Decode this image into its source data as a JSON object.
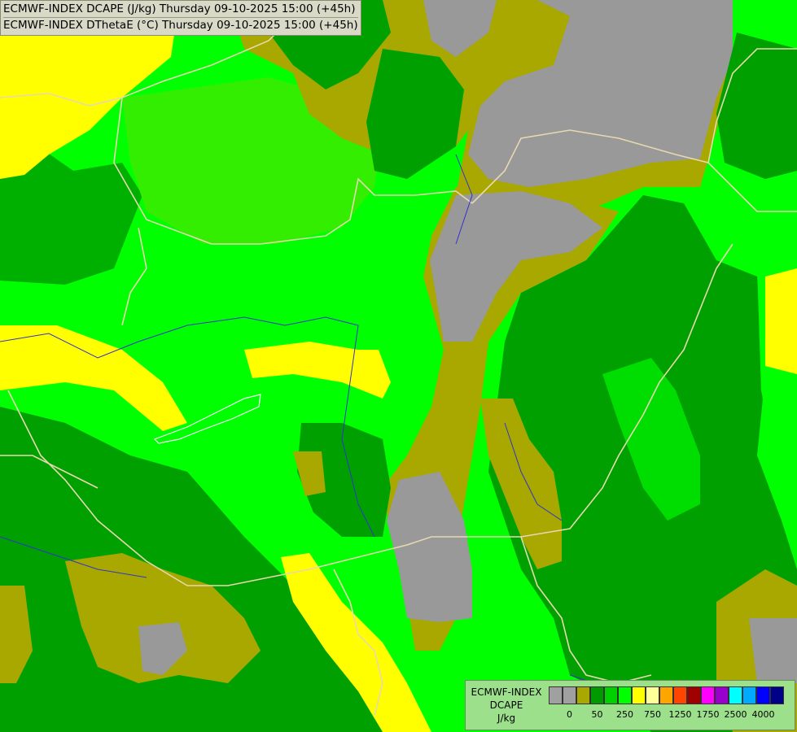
{
  "title": {
    "line1": "ECMWF-INDEX DCAPE (J/kg) Thursday 09-10-2025 15:00 (+45h)",
    "line2": "ECMWF-INDEX DThetaE (°C) Thursday 09-10-2025 15:00 (+45h)"
  },
  "legend": {
    "name": "ECMWF-INDEX",
    "variable": "DCAPE",
    "unit": "J/kg",
    "swatch_colors": [
      "#a0a0a0",
      "#a0a0a0",
      "#a8a800",
      "#009900",
      "#00d000",
      "#00ff00",
      "#ffff00",
      "#ffff99",
      "#ffa500",
      "#ff4500",
      "#a00000",
      "#ff00ff",
      "#9900cc",
      "#00ffff",
      "#00aaff",
      "#0000ff",
      "#000088"
    ],
    "tick_labels": [
      "0",
      "50",
      "250",
      "750",
      "1250",
      "1750",
      "2500",
      "4000"
    ]
  },
  "map_colors": {
    "grey": "#999999",
    "olive": "#a8a800",
    "dark_green": "#00a000",
    "green": "#00e000",
    "bright_green": "#00ff00",
    "yellow": "#ffff00",
    "border": "#e8d8b0",
    "river": "#2222cc",
    "lake": "#ffffff"
  }
}
